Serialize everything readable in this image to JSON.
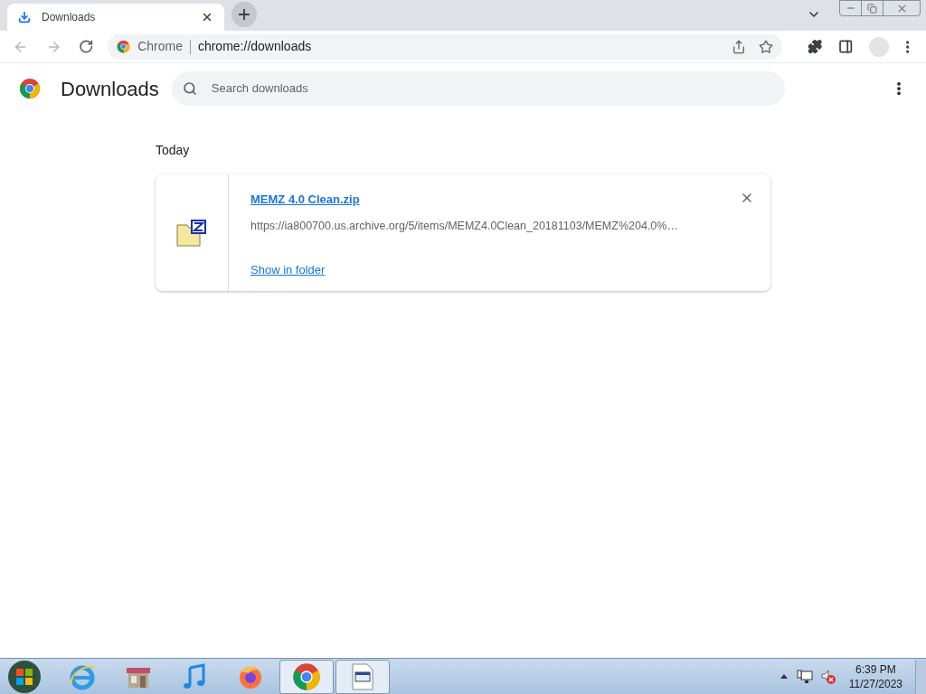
{
  "tabs": [
    {
      "title": "Downloads",
      "selected": true
    }
  ],
  "address": {
    "site": "Chrome",
    "url": "chrome://downloads"
  },
  "page": {
    "title": "Downloads",
    "search": {
      "placeholder": "Search downloads"
    },
    "section": "Today",
    "items": [
      {
        "name": "MEMZ 4.0 Clean.zip",
        "url": "https://ia800700.us.archive.org/5/items/MEMZ4.0Clean_20181103/MEMZ%204.0%…",
        "action": "Show in folder"
      }
    ]
  },
  "taskbar": {
    "items": [
      {
        "kind": "ie",
        "open": false
      },
      {
        "kind": "store",
        "open": false
      },
      {
        "kind": "music",
        "open": false
      },
      {
        "kind": "firefox",
        "open": false
      },
      {
        "kind": "chrome",
        "open": true
      },
      {
        "kind": "app",
        "open": true
      }
    ],
    "time": "6:39 PM",
    "date": "11/27/2023"
  }
}
